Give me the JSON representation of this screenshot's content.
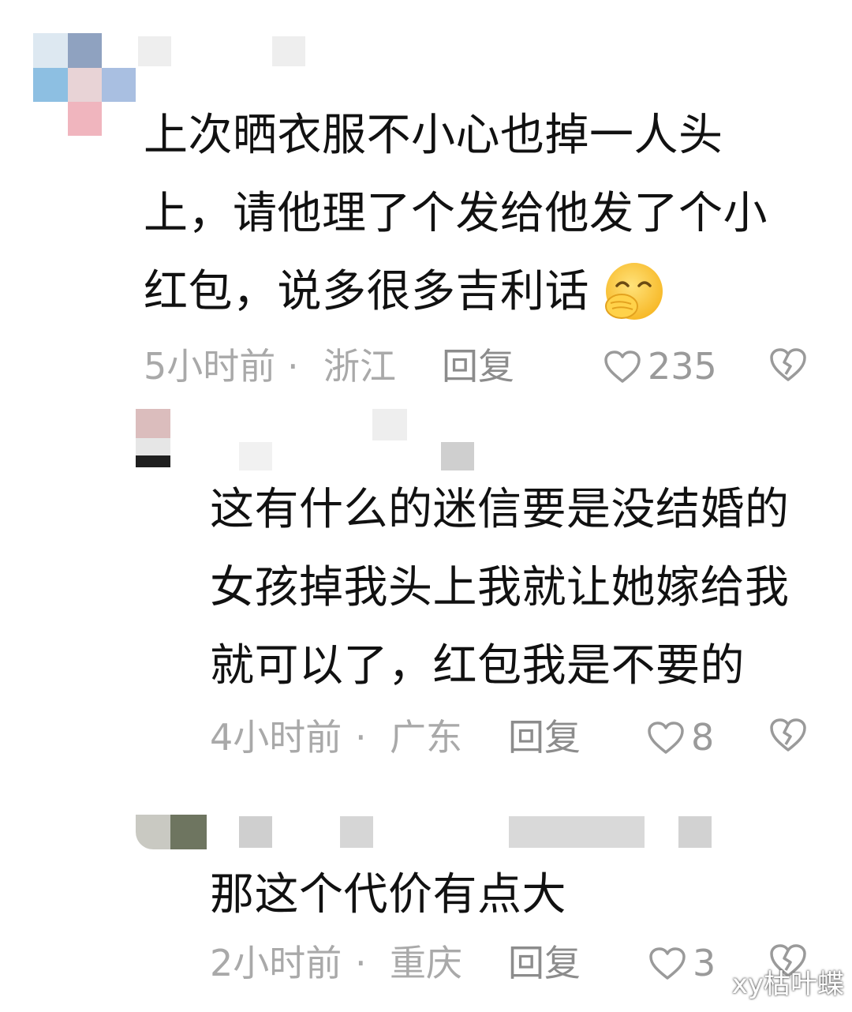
{
  "comments": [
    {
      "lines": [
        "上次晒衣服不小心也掉一人头",
        "上，请他理了个发给他发了个小",
        "红包，说多很多吉利话"
      ],
      "emoji": "smiling-hand-over-mouth",
      "time": "5小时前",
      "dot": "·",
      "location": "浙江",
      "reply": "回复",
      "likes": "235"
    },
    {
      "lines": [
        "这有什么的迷信要是没结婚的",
        "女孩掉我头上我就让她嫁给我",
        "就可以了，红包我是不要的"
      ],
      "time": "4小时前",
      "dot": "·",
      "location": "广东",
      "reply": "回复",
      "likes": "8"
    },
    {
      "lines": [
        "那这个代价有点大"
      ],
      "time": "2小时前",
      "dot": "·",
      "location": "重庆",
      "reply": "回复",
      "likes": "3"
    }
  ],
  "icons": {
    "like": "heart-outline-icon",
    "dislike": "broken-heart-icon"
  },
  "colors": {
    "text": "#111111",
    "meta": "#a9a9a9",
    "icon": "#9a9a9a"
  },
  "watermark": "xy枯叶蝶"
}
